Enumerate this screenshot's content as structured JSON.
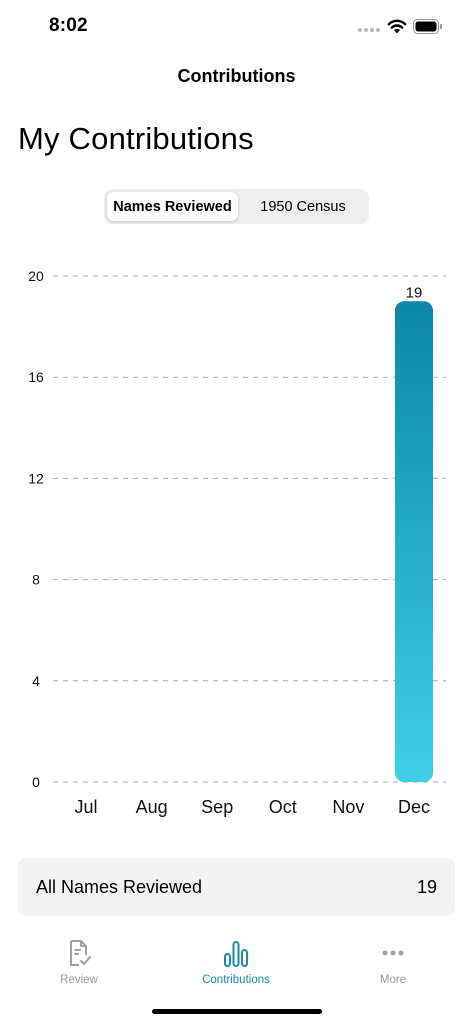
{
  "status_bar": {
    "time": "8:02"
  },
  "nav": {
    "title": "Contributions"
  },
  "page": {
    "large_title": "My Contributions"
  },
  "segmented_control": {
    "options": [
      "Names Reviewed",
      "1950 Census"
    ],
    "selected_index": 0
  },
  "chart_data": {
    "type": "bar",
    "categories": [
      "Jul",
      "Aug",
      "Sep",
      "Oct",
      "Nov",
      "Dec"
    ],
    "values": [
      0,
      0,
      0,
      0,
      0,
      19
    ],
    "data_labels": [
      "",
      "",
      "",
      "",
      "",
      "19"
    ],
    "yticks": [
      0,
      4,
      8,
      12,
      16,
      20
    ],
    "ylim": [
      0,
      20
    ],
    "grid": "horizontal-dashed",
    "bar_color_top": "#0b87a5",
    "bar_color_bottom": "#3fd0e6",
    "title": "",
    "xlabel": "",
    "ylabel": ""
  },
  "summary": {
    "label": "All Names Reviewed",
    "value": "19"
  },
  "tabs": [
    {
      "label": "Review",
      "icon": "review-document-icon",
      "active": false
    },
    {
      "label": "Contributions",
      "icon": "bar-chart-icon",
      "active": true
    },
    {
      "label": "More",
      "icon": "more-dots-icon",
      "active": false
    }
  ],
  "colors": {
    "accent": "#1a8aab",
    "inactive": "#9a9a9a"
  }
}
